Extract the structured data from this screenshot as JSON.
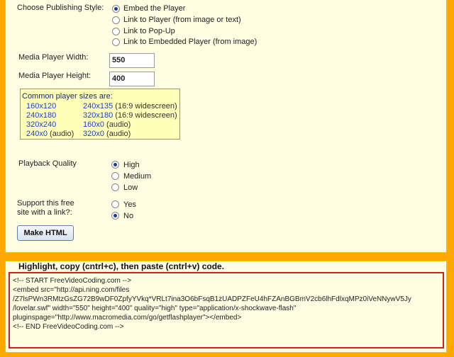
{
  "publishing": {
    "label": "Choose Publishing Style:",
    "options": [
      {
        "label": "Embed the Player",
        "checked": true
      },
      {
        "label": "Link to Player (from image or text)",
        "checked": false
      },
      {
        "label": "Link to Pop-Up",
        "checked": false
      },
      {
        "label": "Link to Embedded Player (from image)",
        "checked": false
      }
    ]
  },
  "width": {
    "label": "Media Player Width:",
    "value": "550"
  },
  "height": {
    "label": "Media Player Height:",
    "value": "400"
  },
  "sizes": {
    "title": "Common player sizes are:",
    "rows": [
      [
        {
          "link": "160x120",
          "note": ""
        },
        {
          "link": "240x135",
          "note": " (16:9 widescreen)"
        }
      ],
      [
        {
          "link": "240x180",
          "note": ""
        },
        {
          "link": "320x180",
          "note": " (16:9 widescreen)"
        }
      ],
      [
        {
          "link": "320x240",
          "note": ""
        },
        {
          "link": "160x0",
          "note": " (audio)"
        }
      ],
      [
        {
          "link": "240x0",
          "note": " (audio)"
        },
        {
          "link": "320x0",
          "note": " (audio)"
        }
      ]
    ]
  },
  "quality": {
    "label": "Playback Quality",
    "options": [
      {
        "label": "High",
        "checked": true
      },
      {
        "label": "Medium",
        "checked": false
      },
      {
        "label": "Low",
        "checked": false
      }
    ]
  },
  "support": {
    "label_line1": "Support this free",
    "label_line2": "site with a link?:",
    "options": [
      {
        "label": "Yes",
        "checked": false
      },
      {
        "label": "No",
        "checked": true
      }
    ]
  },
  "make_html_button": "Make HTML",
  "code_section": {
    "label": "Highlight, copy (cntrl+c), then paste (cntrl+v) code.",
    "lines": [
      "<!-- START FreeVideoCoding.com -->",
      "<embed src=\"http://api.ning.com/files",
      "/Z7lsPWn3RMtzGsZG72B9wDF0ZpfyYVkq*VRLt7ina3O6bFsqB1zUADPZFeU4hFZAnBGBmV2cb6lhFdlxqMPz0iVeNNywV5Jy",
      "/lovelar.swf\" width=\"550\" height=\"400\" quality=\"high\" type=\"application/x-shockwave-flash\"",
      "pluginspage=\"http://www.macromedia.com/go/getflashplayer\"></embed>",
      "<!-- END FreeVideoCoding.com -->"
    ]
  }
}
